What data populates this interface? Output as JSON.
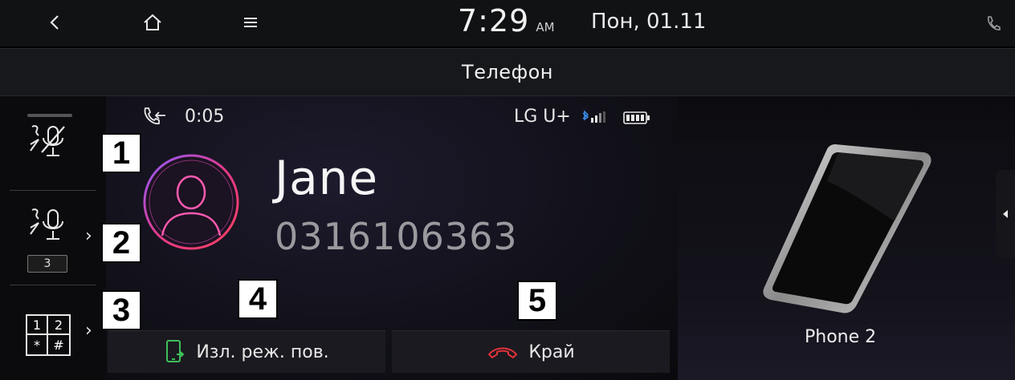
{
  "statusbar": {
    "time": "7:29",
    "ampm": "AM",
    "date": "Пон, 01.11",
    "icons": [
      "back-icon",
      "home-icon",
      "menu-icon",
      "phone-status-icon"
    ]
  },
  "header": {
    "title": "Телефон"
  },
  "sidebar": {
    "mic_level_badge": "3",
    "keypad_keys": [
      "1",
      "2",
      "*",
      "#"
    ]
  },
  "call": {
    "duration": "0:05",
    "carrier": "LG U+",
    "contact_name": "Jane",
    "contact_number": "0316106363"
  },
  "actions": {
    "private_mode_label": "Изл. реж. пов.",
    "end_call_label": "Край"
  },
  "device": {
    "label": "Phone 2"
  },
  "markers": [
    "1",
    "2",
    "3",
    "4",
    "5"
  ],
  "colors": {
    "end_call_red": "#e2323a",
    "private_mode_green": "#3fbf5a",
    "avatar_ring": "#e13a8a",
    "bluetooth_blue": "#3a8fe8"
  }
}
